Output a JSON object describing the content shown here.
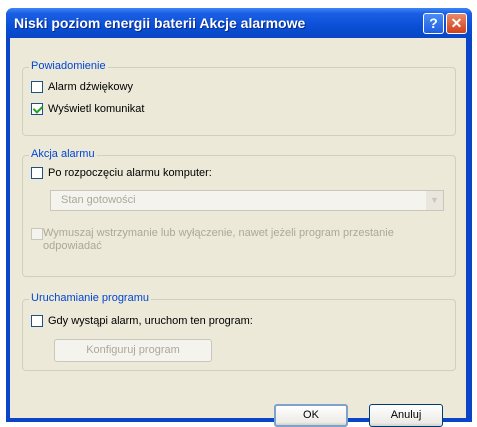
{
  "window": {
    "title": "Niski poziom energii baterii Akcje alarmowe",
    "help_label": "?",
    "close_label": "✕"
  },
  "notification": {
    "legend": "Powiadomienie",
    "sound_alarm": {
      "label": "Alarm dźwiękowy",
      "checked": false
    },
    "show_message": {
      "label": "Wyświetl komunikat",
      "checked": true
    }
  },
  "alarm_action": {
    "legend": "Akcja alarmu",
    "when_alarm": {
      "label": "Po rozpoczęciu alarmu komputer:",
      "checked": false
    },
    "state_select": {
      "value": "Stan gotowości",
      "arrow": "▼"
    },
    "force_shutdown": {
      "label": "Wymuszaj wstrzymanie lub wyłączenie, nawet jeżeli program przestanie odpowiadać",
      "checked": false
    }
  },
  "run_program": {
    "legend": "Uruchamianie programu",
    "run_on_alarm": {
      "label": "Gdy wystąpi alarm, uruchom ten program:",
      "checked": false
    },
    "configure_label": "Konfiguruj program"
  },
  "buttons": {
    "ok": "OK",
    "cancel": "Anuluj"
  },
  "colors": {
    "title_bar": "#0a4fd6",
    "dialog_bg": "#ece9d8",
    "group_legend": "#0046d5",
    "disabled_text": "#aca899",
    "checkmark": "#21a121"
  }
}
